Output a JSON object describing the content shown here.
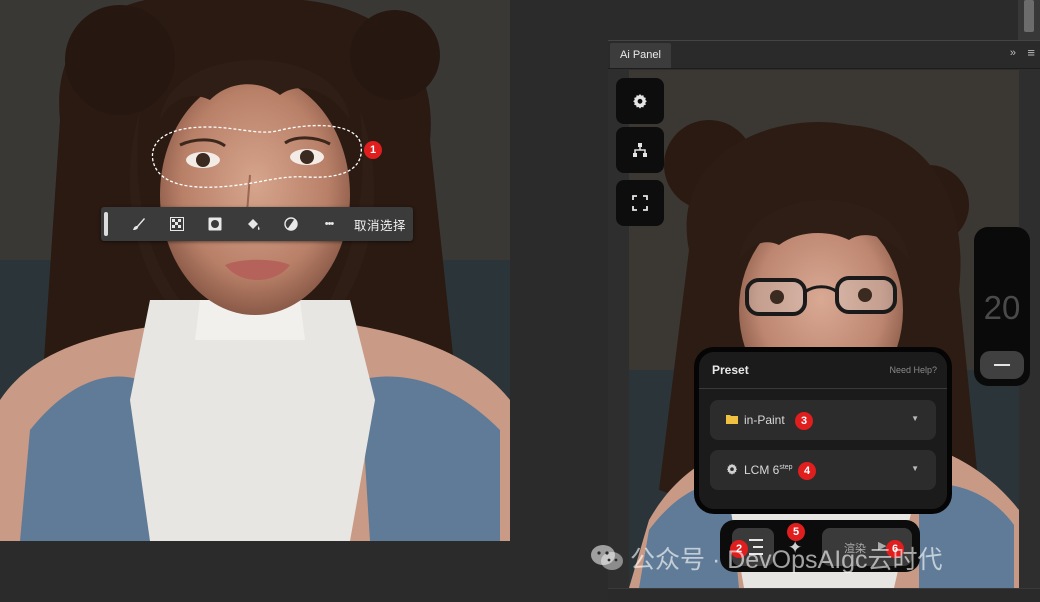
{
  "canvas": {
    "toolbar": {
      "tools": [
        {
          "name": "brush-icon",
          "glyph": "✎"
        },
        {
          "name": "transparency-icon",
          "glyph": "▦"
        },
        {
          "name": "mask-icon",
          "glyph": "◙"
        },
        {
          "name": "fill-icon",
          "glyph": "⬙"
        },
        {
          "name": "invert-icon",
          "glyph": "◑"
        },
        {
          "name": "more-icon",
          "glyph": "•••"
        }
      ],
      "deselect_label": "取消选择"
    },
    "badge_1": "1"
  },
  "panel": {
    "tab_label": "Ai Panel",
    "collapse_glyph": "»",
    "menu_glyph": "≡",
    "side_buttons": [
      {
        "name": "settings-gear-button",
        "icon": "gear-icon"
      },
      {
        "name": "workflow-tree-button",
        "icon": "hierarchy-icon"
      },
      {
        "name": "fullscreen-button",
        "icon": "expand-corners-icon"
      }
    ],
    "steps": {
      "value": "20",
      "minus_glyph": "−"
    },
    "preset": {
      "title": "Preset",
      "help": "Need Help?",
      "mode": {
        "label": "in-Paint",
        "icon": "folder-icon"
      },
      "model": {
        "label": "LCM 6",
        "sup": "step",
        "icon": "gear-icon"
      },
      "caret": "▼"
    },
    "actions": {
      "render_label": "渲染",
      "render_arrow": "▶",
      "sparkle": "✦"
    },
    "badges": [
      "2",
      "3",
      "4",
      "5",
      "6"
    ]
  },
  "watermark": {
    "text": "公众号 · DevOpsAIgc云时代"
  },
  "colors": {
    "badge_red": "#e01e1e",
    "folder_yellow": "#f0c040",
    "dark_button": "#0d0d0d"
  }
}
